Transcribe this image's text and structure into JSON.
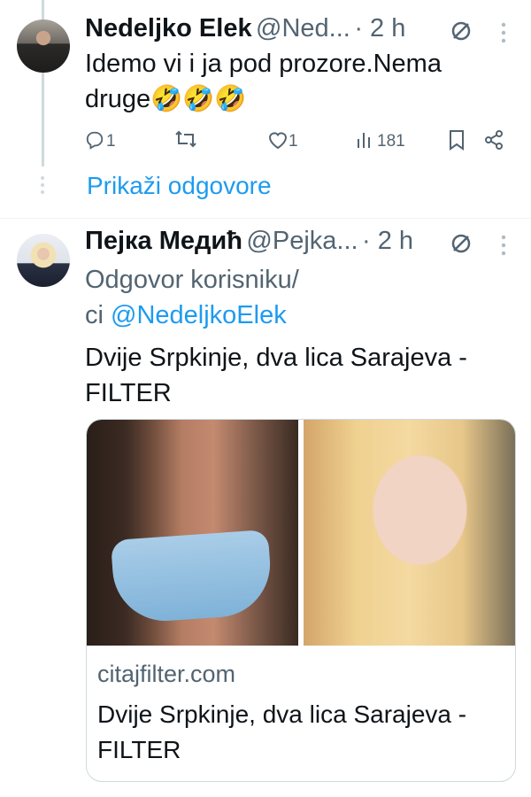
{
  "tweet1": {
    "name": "Nedeljko Elek",
    "handle": "@Ned...",
    "time": "· 2 h",
    "text_line1": "Idemo vi i ja pod prozore.Nema",
    "text_line2": "druge",
    "emojis": "🤣🤣🤣",
    "actions": {
      "replies": "1",
      "retweets": "",
      "likes": "1",
      "views": "181"
    }
  },
  "show_replies": "Prikaži odgovore",
  "tweet2": {
    "name": "Пејка Медић",
    "handle": "@Pejka...",
    "time": "· 2 h",
    "reply_to_prefix": "Odgovor korisniku/",
    "reply_to_line2_prefix": "ci ",
    "reply_to_handle": "@NedeljkoElek",
    "text_line1": "Dvije Srpkinje, dva lica Sarajeva -",
    "text_line2": "FILTER",
    "card": {
      "domain": "citajfilter.com",
      "title": "Dvije Srpkinje, dva lica Sarajeva - FILTER"
    }
  },
  "colors": {
    "accent": "#1d9bf0",
    "text": "#0f1419",
    "muted": "#536471"
  }
}
